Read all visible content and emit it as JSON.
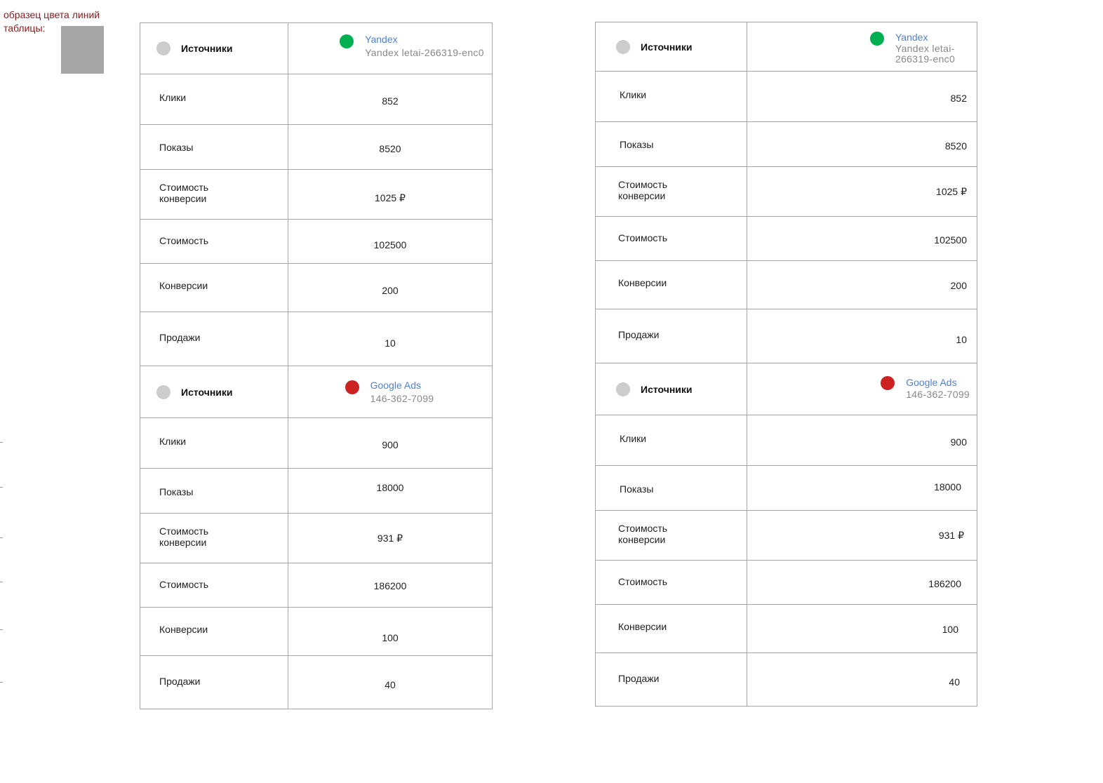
{
  "sample": {
    "caption": "образец цвета линий таблицы:",
    "swatch_color": "#a6a6a6"
  },
  "colors": {
    "line": "#a6a6a6",
    "yandex_dot": "#00b050",
    "google_dot": "#cc2222",
    "header_dot": "#cccccc",
    "link": "#4f7fd6"
  },
  "tables": {
    "left": {
      "yandex": {
        "header": "Источники",
        "source_name": "Yandex",
        "source_account": "Yandex letai-266319-enc0",
        "rows": [
          {
            "label": "Клики",
            "value": "852"
          },
          {
            "label": "Показы",
            "value": "8520"
          },
          {
            "label": "Стоимость конверсии",
            "value": "1025 ₽"
          },
          {
            "label": "Стоимость",
            "value": "102500"
          },
          {
            "label": "Конверсии",
            "value": "200"
          },
          {
            "label": "Продажи",
            "value": "10"
          }
        ]
      },
      "google": {
        "header": "Источники",
        "source_name": "Google Ads",
        "source_account": "146-362-7099",
        "rows": [
          {
            "label": "Клики",
            "value": "900"
          },
          {
            "label": "Показы",
            "value": "18000"
          },
          {
            "label": "Стоимость конверсии",
            "value": "931 ₽"
          },
          {
            "label": "Стоимость",
            "value": "186200"
          },
          {
            "label": "Конверсии",
            "value": "100"
          },
          {
            "label": "Продажи",
            "value": "40"
          }
        ]
      }
    },
    "right": {
      "yandex": {
        "header": "Источники",
        "source_name": "Yandex",
        "source_account": "Yandex letai-266319-enc0",
        "rows": [
          {
            "label": "Клики",
            "value": "852"
          },
          {
            "label": "Показы",
            "value": "8520"
          },
          {
            "label": "Стоимость конверсии",
            "value": "1025 ₽"
          },
          {
            "label": "Стоимость",
            "value": "102500"
          },
          {
            "label": "Конверсии",
            "value": "200"
          },
          {
            "label": "Продажи",
            "value": "10"
          }
        ]
      },
      "google": {
        "header": "Источники",
        "source_name": "Google Ads",
        "source_account": "146-362-7099",
        "rows": [
          {
            "label": "Клики",
            "value": "900"
          },
          {
            "label": "Показы",
            "value": "18000"
          },
          {
            "label": "Стоимость конверсии",
            "value": "931 ₽"
          },
          {
            "label": "Стоимость",
            "value": "186200"
          },
          {
            "label": "Конверсии",
            "value": "100"
          },
          {
            "label": "Продажи",
            "value": "40"
          }
        ]
      }
    }
  }
}
